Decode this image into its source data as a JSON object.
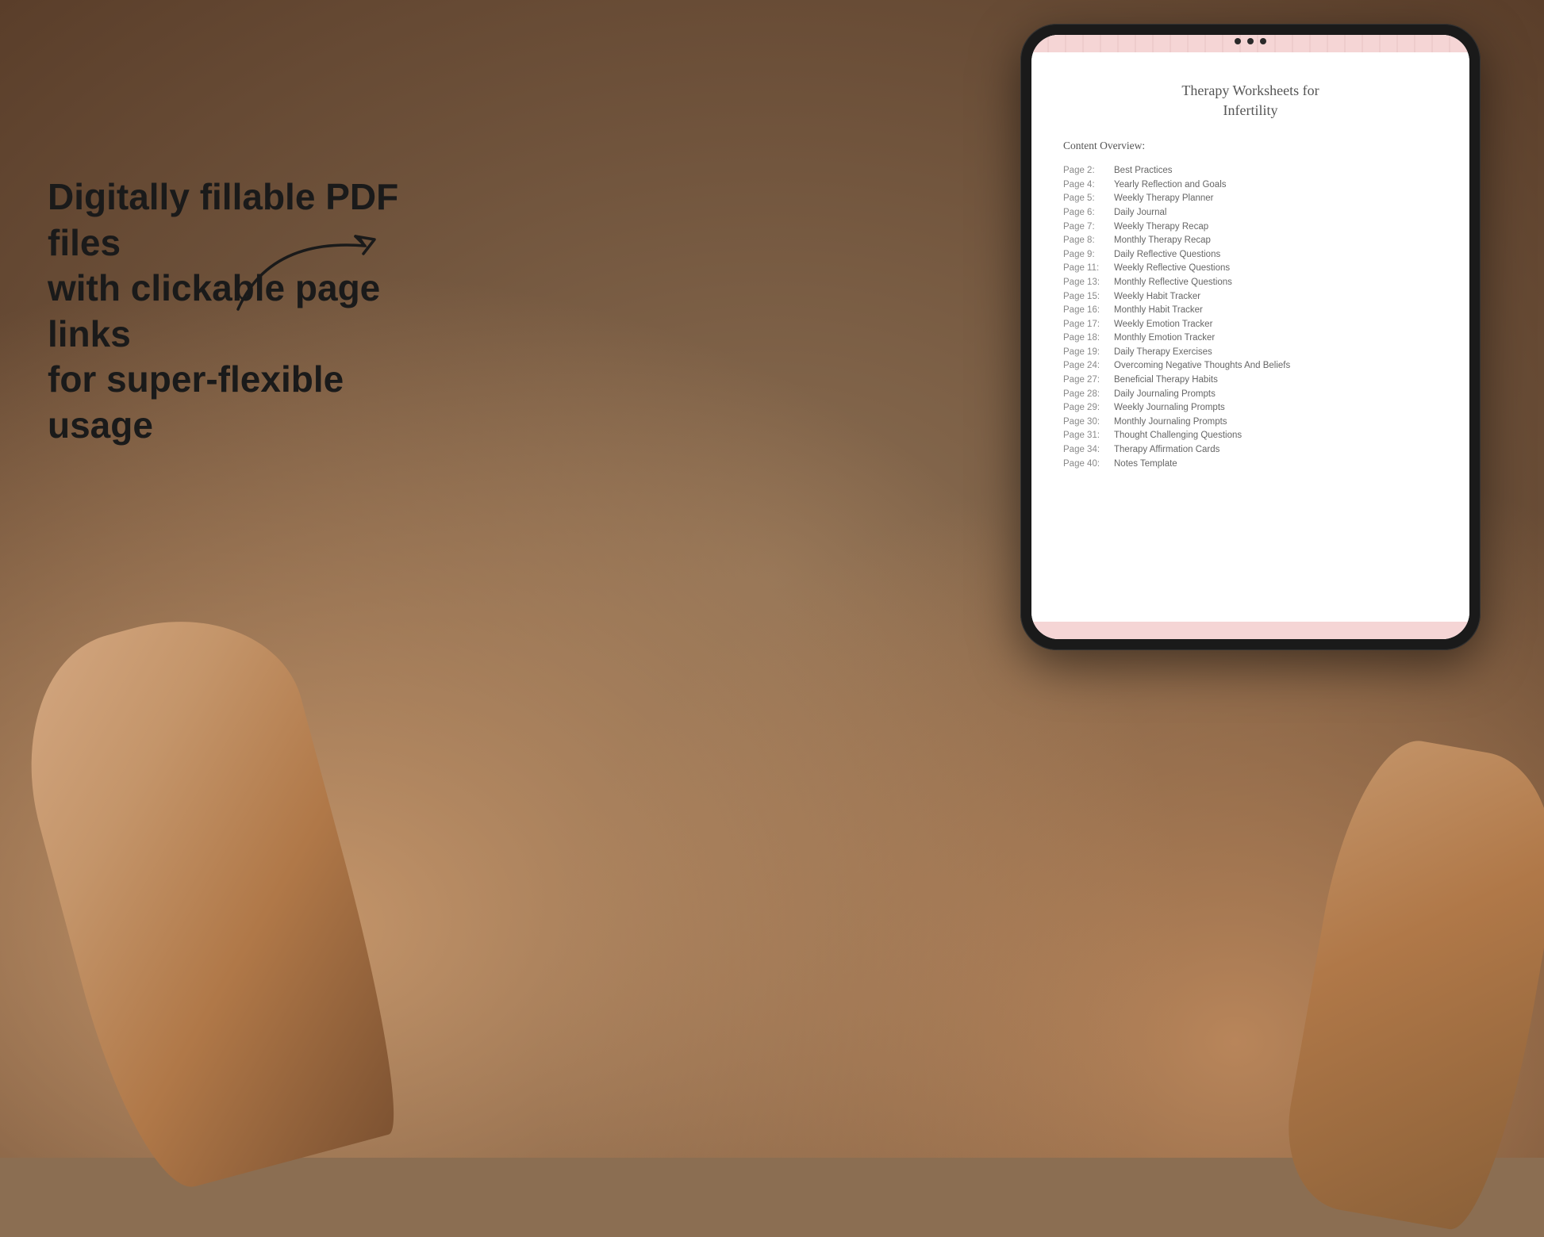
{
  "scene": {
    "arrow_label": "→",
    "main_text_line1": "Digitally fillable PDF files",
    "main_text_line2": "with clickable page links",
    "main_text_line3": "for super-flexible usage"
  },
  "document": {
    "title_line1": "Therapy Worksheets for",
    "title_line2": "Infertility",
    "overview_label": "Content Overview:",
    "toc": [
      {
        "page": "Page 2:",
        "title": "Best Practices"
      },
      {
        "page": "Page 4:",
        "title": "Yearly Reflection and Goals"
      },
      {
        "page": "Page 5:",
        "title": "Weekly Therapy Planner"
      },
      {
        "page": "Page 6:",
        "title": "Daily Journal"
      },
      {
        "page": "Page 7:",
        "title": "Weekly Therapy Recap"
      },
      {
        "page": "Page 8:",
        "title": "Monthly Therapy Recap"
      },
      {
        "page": "Page 9:",
        "title": "Daily Reflective Questions"
      },
      {
        "page": "Page 11:",
        "title": "Weekly Reflective Questions"
      },
      {
        "page": "Page 13:",
        "title": "Monthly Reflective Questions"
      },
      {
        "page": "Page 15:",
        "title": "Weekly Habit Tracker"
      },
      {
        "page": "Page 16:",
        "title": "Monthly Habit Tracker"
      },
      {
        "page": "Page 17:",
        "title": "Weekly Emotion Tracker"
      },
      {
        "page": "Page 18:",
        "title": "Monthly Emotion Tracker"
      },
      {
        "page": "Page 19:",
        "title": "Daily Therapy Exercises"
      },
      {
        "page": "Page 24:",
        "title": "Overcoming Negative Thoughts And Beliefs"
      },
      {
        "page": "Page 27:",
        "title": "Beneficial Therapy Habits"
      },
      {
        "page": "Page 28:",
        "title": "Daily Journaling Prompts"
      },
      {
        "page": "Page 29:",
        "title": "Weekly Journaling Prompts"
      },
      {
        "page": "Page 30:",
        "title": "Monthly Journaling Prompts"
      },
      {
        "page": "Page 31:",
        "title": "Thought Challenging Questions"
      },
      {
        "page": "Page 34:",
        "title": "Therapy Affirmation Cards"
      },
      {
        "page": "Page 40:",
        "title": "Notes Template"
      }
    ]
  }
}
